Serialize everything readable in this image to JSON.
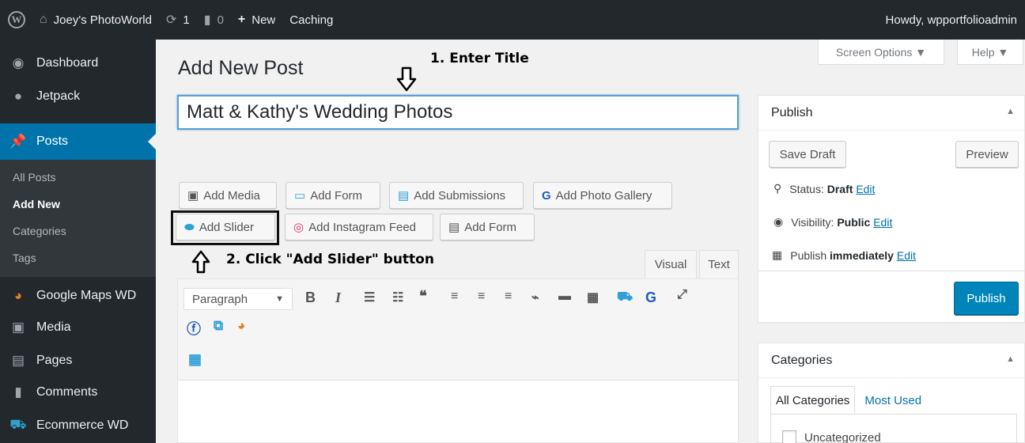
{
  "admin_bar": {
    "site_name": "Joey's PhotoWorld",
    "updates_count": "1",
    "comments_count": "0",
    "new_label": "New",
    "caching_label": "Caching",
    "greeting": "Howdy, wpportfolioadmin"
  },
  "sidebar": {
    "items": [
      {
        "label": "Dashboard",
        "icon": "dashboard-icon"
      },
      {
        "label": "Jetpack",
        "icon": "jetpack-icon"
      },
      {
        "label": "Posts",
        "icon": "pin-icon"
      },
      {
        "label": "Google Maps WD",
        "icon": "map-icon"
      },
      {
        "label": "Media",
        "icon": "media-icon"
      },
      {
        "label": "Pages",
        "icon": "pages-icon"
      },
      {
        "label": "Comments",
        "icon": "comment-icon"
      },
      {
        "label": "Ecommerce WD",
        "icon": "cart-icon"
      }
    ],
    "submenu": [
      "All Posts",
      "Add New",
      "Categories",
      "Tags"
    ]
  },
  "screen_options": {
    "label": "Screen Options ▼",
    "help": "Help ▼"
  },
  "page": {
    "title": "Add New Post",
    "post_title_value": "Matt & Kathy's Wedding Photos",
    "annotation_1": "1. Enter Title",
    "annotation_2": "2. Click \"Add Slider\" button"
  },
  "media_buttons": {
    "row1": [
      "Add Media",
      "Add Form",
      "Add Submissions",
      "Add Photo Gallery"
    ],
    "row2": [
      "Add Slider",
      "Add Instagram Feed",
      "Add Form"
    ]
  },
  "editor": {
    "tabs": [
      "Visual",
      "Text"
    ],
    "format": "Paragraph"
  },
  "publish_box": {
    "title": "Publish",
    "save_draft": "Save Draft",
    "preview": "Preview",
    "status_label": "Status:",
    "status_value": "Draft",
    "visibility_label": "Visibility:",
    "visibility_value": "Public",
    "publish_label": "Publish",
    "publish_value": "immediately",
    "edit_link": "Edit",
    "publish_button": "Publish"
  },
  "categories_box": {
    "title": "Categories",
    "tab_all": "All Categories",
    "tab_most_used": "Most Used",
    "item": "Uncategorized"
  },
  "colors": {
    "admin_dark": "#23282d",
    "accent": "#0073aa",
    "publish_blue": "#0085ba",
    "focus": "#5b9dd9"
  }
}
